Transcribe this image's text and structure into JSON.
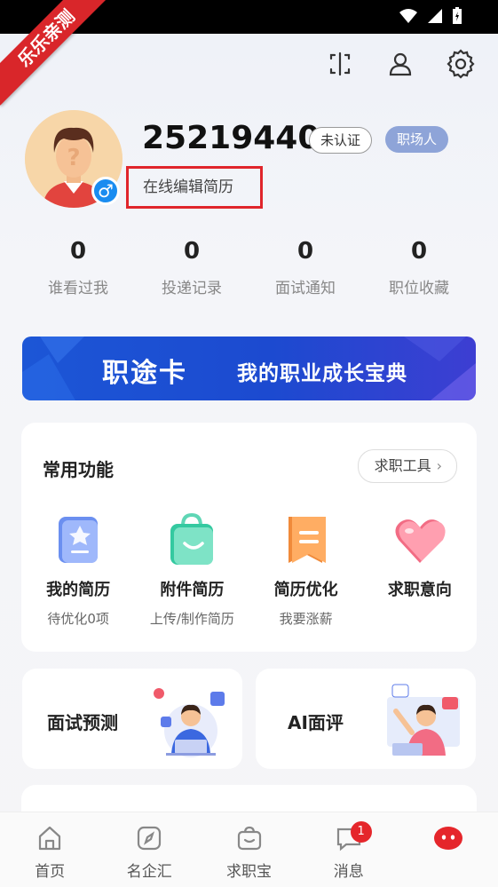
{
  "ribbon": "乐乐亲测",
  "profile": {
    "user_id": "25219440",
    "badge_unverified": "未认证",
    "badge_role": "职场人",
    "gender_symbol": "♂",
    "edit_resume": "在线编辑简历"
  },
  "stats": [
    {
      "value": "0",
      "label": "谁看过我"
    },
    {
      "value": "0",
      "label": "投递记录"
    },
    {
      "value": "0",
      "label": "面试通知"
    },
    {
      "value": "0",
      "label": "职位收藏"
    }
  ],
  "banner": {
    "title": "职途卡",
    "subtitle": "我的职业成长宝典"
  },
  "common": {
    "title": "常用功能",
    "tools_button": "求职工具",
    "items": [
      {
        "label": "我的简历",
        "sub": "待优化0项",
        "icon": "resume-icon"
      },
      {
        "label": "附件简历",
        "sub": "上传/制作简历",
        "icon": "attachment-bag-icon"
      },
      {
        "label": "简历优化",
        "sub": "我要涨薪",
        "icon": "bookmark-icon"
      },
      {
        "label": "求职意向",
        "sub": "",
        "icon": "heart-icon"
      }
    ]
  },
  "cards": {
    "interview_prediction": "面试预测",
    "ai_review": "AI面评"
  },
  "tabbar": {
    "items": [
      {
        "label": "首页",
        "icon": "home-icon"
      },
      {
        "label": "名企汇",
        "icon": "compass-icon"
      },
      {
        "label": "求职宝",
        "icon": "bag-icon"
      },
      {
        "label": "消息",
        "icon": "message-icon",
        "badge": "1"
      },
      {
        "label": "",
        "icon": "mascot-icon"
      }
    ]
  },
  "colors": {
    "accent": "#1a8cf0",
    "highlight": "#e0252b",
    "banner": "#1c4ad0"
  }
}
